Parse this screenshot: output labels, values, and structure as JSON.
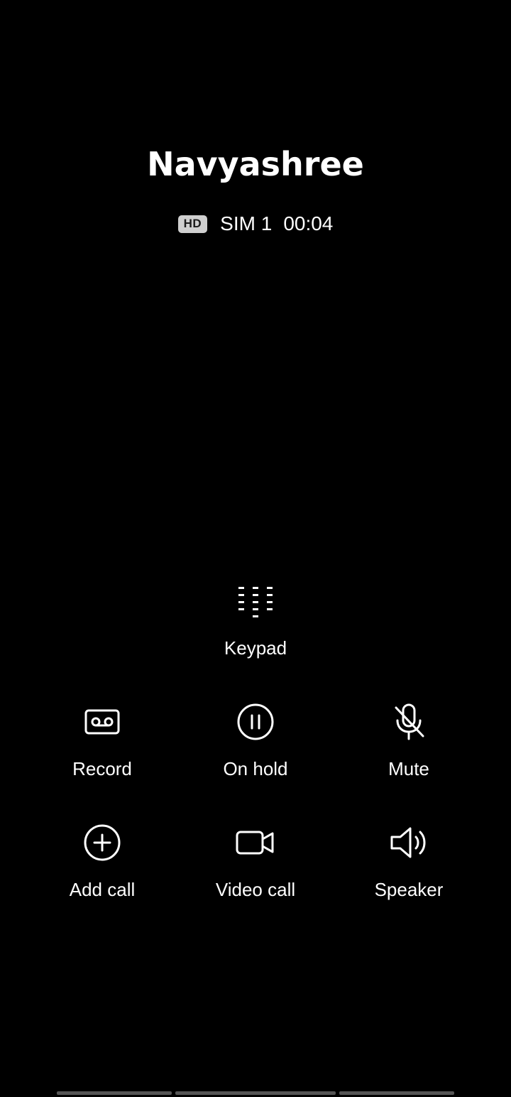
{
  "caller": {
    "name": "Navyashree"
  },
  "call_info": {
    "hd_badge": "HD",
    "sim": "SIM 1",
    "duration": "00:04"
  },
  "keypad": {
    "label": "Keypad",
    "icon": "dialpad-icon"
  },
  "controls": [
    {
      "label": "Record",
      "icon": "record-icon"
    },
    {
      "label": "On hold",
      "icon": "pause-icon"
    },
    {
      "label": "Mute",
      "icon": "mic-off-icon"
    },
    {
      "label": "Add call",
      "icon": "add-circle-icon"
    },
    {
      "label": "Video call",
      "icon": "video-camera-icon"
    },
    {
      "label": "Speaker",
      "icon": "speaker-icon"
    }
  ],
  "colors": {
    "background": "#000000",
    "foreground": "#ffffff",
    "badge": "#cfcfcf"
  }
}
